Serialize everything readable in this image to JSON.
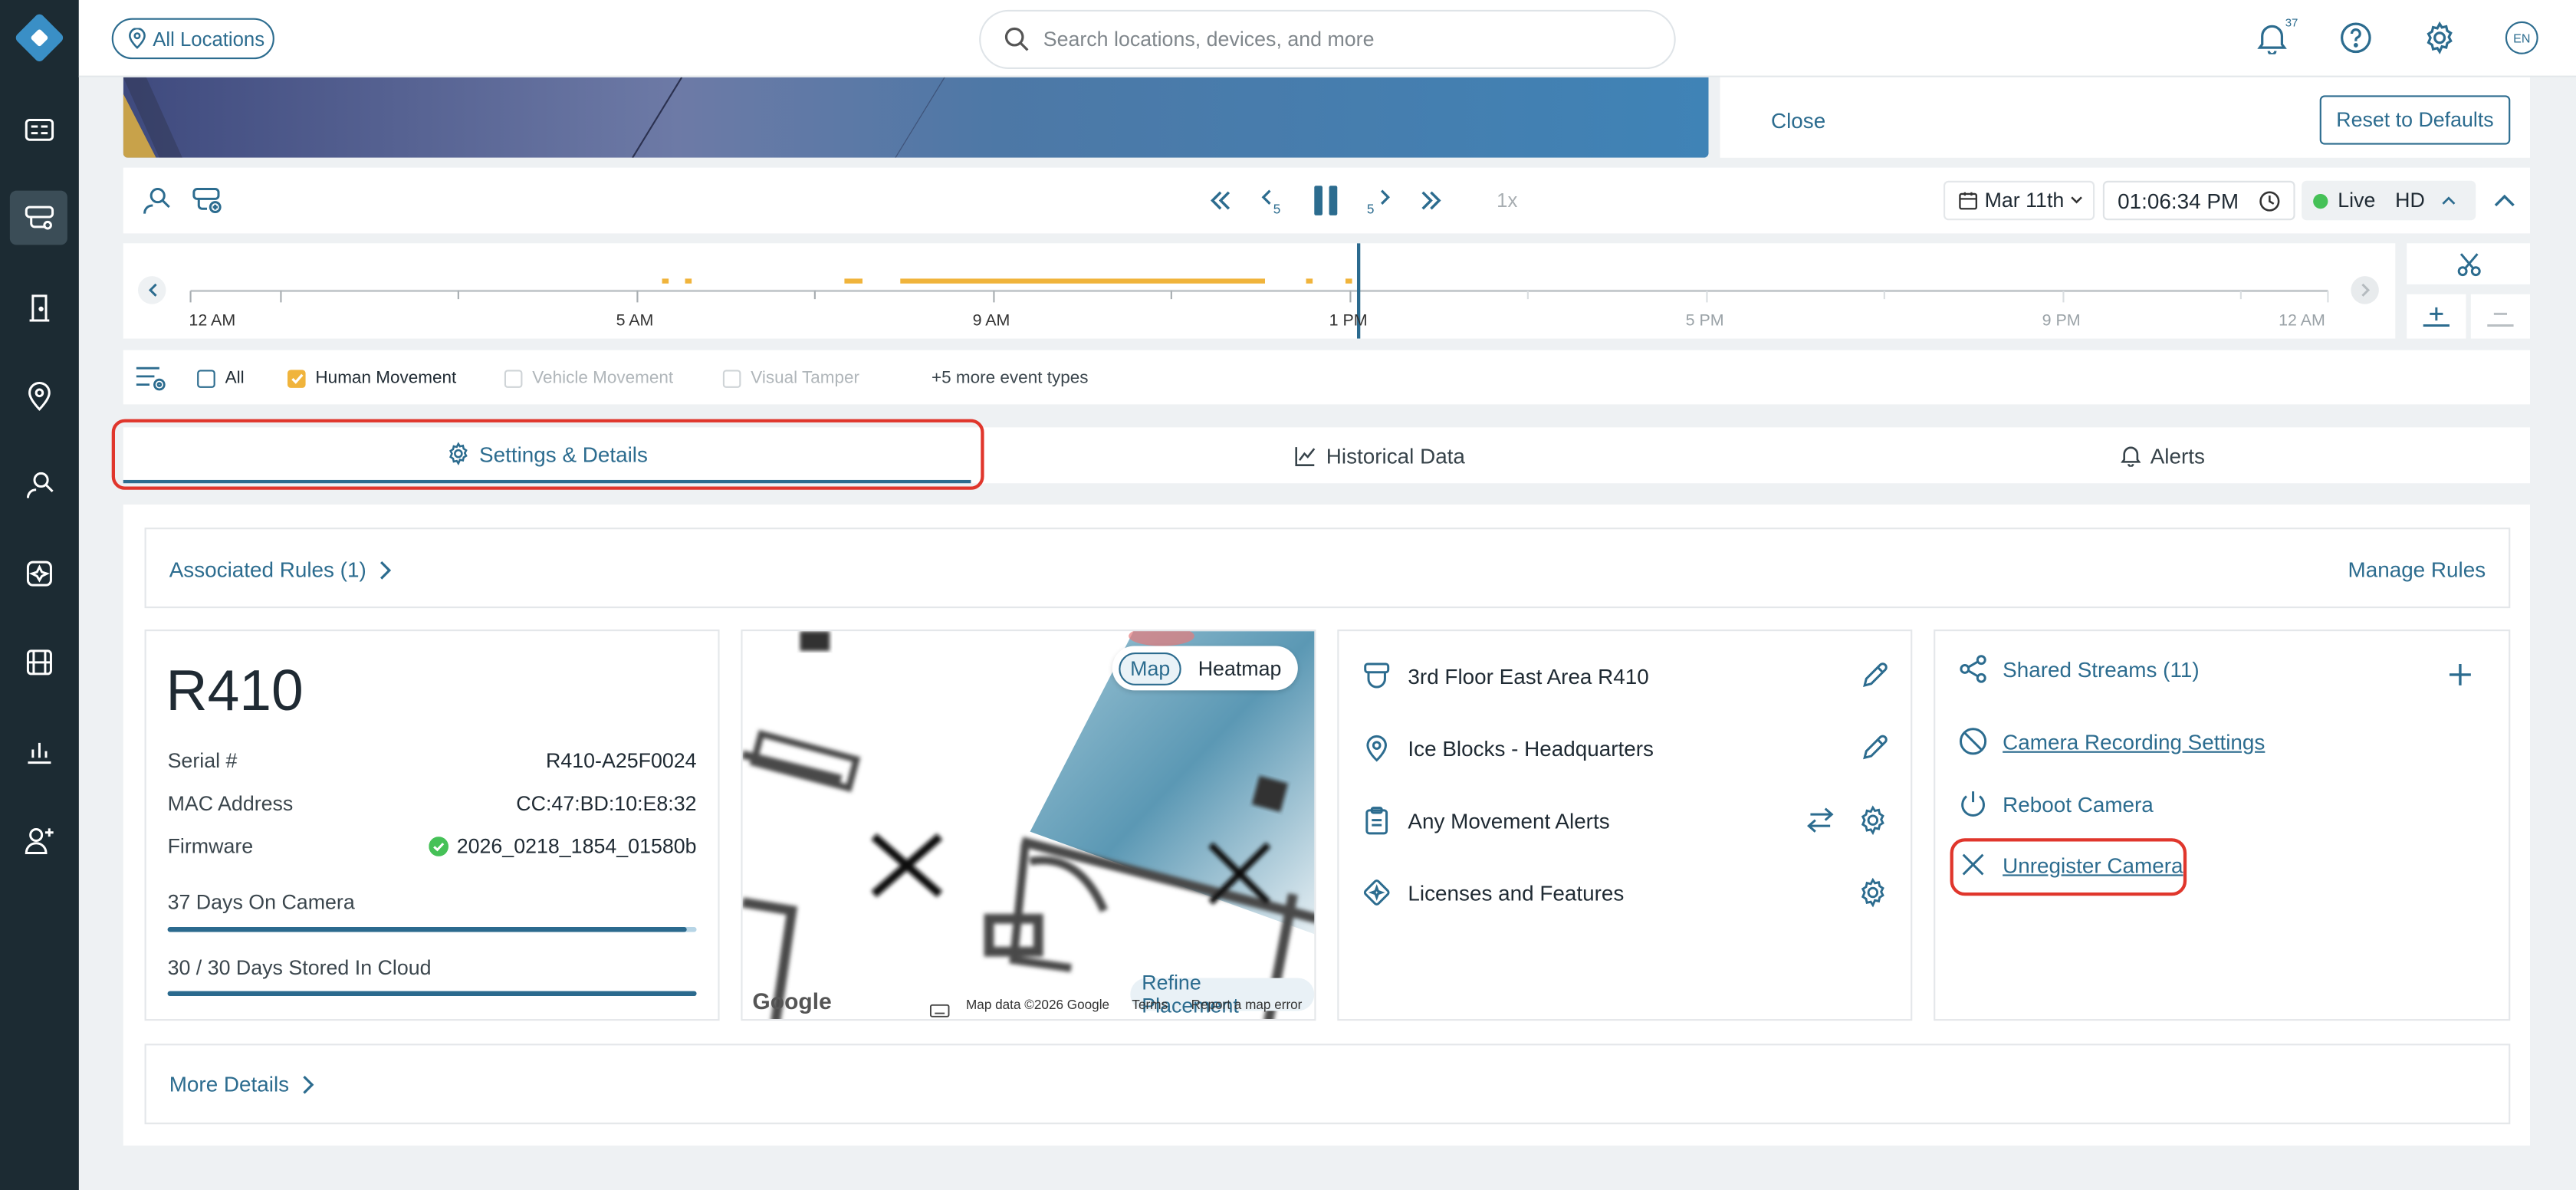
{
  "topbar": {
    "location_button": "All Locations",
    "search_placeholder": "Search locations, devices, and more",
    "notification_count": "37",
    "language": "EN"
  },
  "panel": {
    "close_label": "Close",
    "reset_label": "Reset to Defaults"
  },
  "playback": {
    "speed": "1x",
    "date": "Mar 11th",
    "time": "01:06:34 PM",
    "live_label": "Live",
    "quality": "HD"
  },
  "timeline": {
    "ticks": [
      "12 AM",
      "5 AM",
      "9 AM",
      "1 PM",
      "5 PM",
      "9 PM",
      "12 AM"
    ]
  },
  "filters": {
    "all": "All",
    "human": "Human Movement",
    "vehicle": "Vehicle Movement",
    "tamper": "Visual Tamper",
    "more": "+5 more event types"
  },
  "tabs": {
    "settings": "Settings & Details",
    "historical": "Historical Data",
    "alerts": "Alerts"
  },
  "rules": {
    "associated": "Associated Rules (1)",
    "manage": "Manage Rules"
  },
  "camera": {
    "model": "R410",
    "serial_label": "Serial #",
    "serial": "R410-A25F0024",
    "mac_label": "MAC Address",
    "mac": "CC:47:BD:10:E8:32",
    "firmware_label": "Firmware",
    "firmware": "2026_0218_1854_01580b",
    "days_on_camera": "37 Days On Camera",
    "days_on_camera_fill": 0.98,
    "cloud_storage": "30 / 30 Days Stored In Cloud",
    "cloud_fill": 1.0
  },
  "map": {
    "map_tab": "Map",
    "heatmap_tab": "Heatmap",
    "refine": "Refine Placement",
    "google": "Google",
    "attribution": "Map data ©2026 Google",
    "terms": "Terms",
    "report": "Report a map error"
  },
  "details": {
    "name": "3rd Floor East Area R410",
    "site": "Ice Blocks - Headquarters",
    "alerts": "Any Movement Alerts",
    "licenses": "Licenses and Features"
  },
  "actions": {
    "shared": "Shared Streams (11)",
    "recording": "Camera Recording Settings",
    "reboot": "Reboot Camera",
    "unregister": "Unregister Camera"
  },
  "more_details": "More Details",
  "colors": {
    "accent": "#2c6c8f",
    "sidebar": "#1c2b33",
    "event": "#f0b43c",
    "highlight": "#e0362c",
    "live": "#45c157"
  }
}
